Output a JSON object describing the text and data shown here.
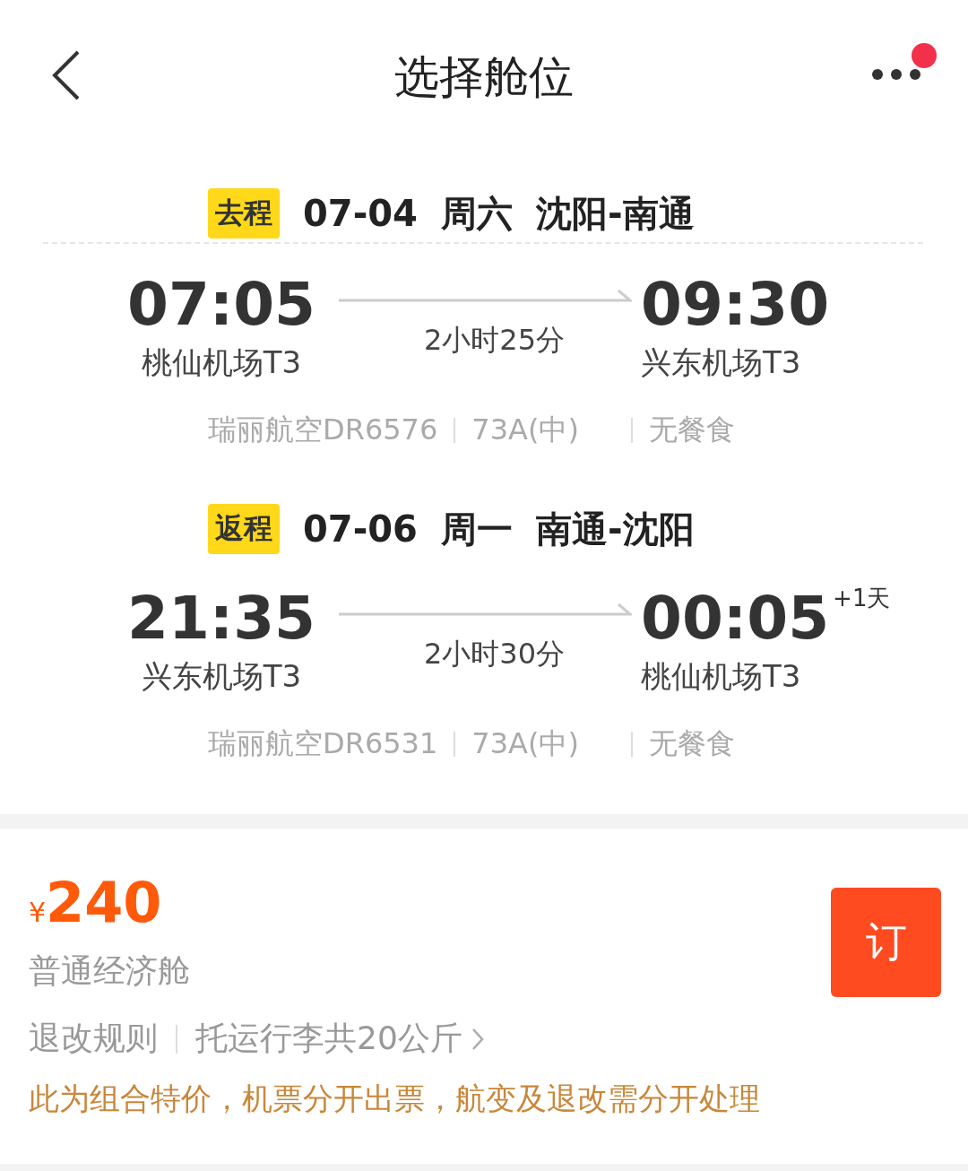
{
  "header": {
    "title": "选择舱位",
    "notification": true
  },
  "trips": [
    {
      "tag": "去程",
      "date": "07-04",
      "weekday": "周六",
      "route": "沈阳-南通",
      "depart_time": "07:05",
      "depart_airport": "桃仙机场T3",
      "duration": "2小时25分",
      "arrive_time": "09:30",
      "arrive_airport": "兴东机场T3",
      "flight": "瑞丽航空DR6576",
      "aircraft": "73A(中)",
      "meal": "无餐食"
    },
    {
      "tag": "返程",
      "date": "07-06",
      "weekday": "周一",
      "route": "南通-沈阳",
      "depart_time": "21:35",
      "depart_airport": "兴东机场T3",
      "duration": "2小时30分",
      "arrive_time": "00:05",
      "arrive_offset": "+1天",
      "arrive_airport": "桃仙机场T3",
      "flight": "瑞丽航空DR6531",
      "aircraft": "73A(中)",
      "meal": "无餐食"
    }
  ],
  "fare": {
    "currency": "¥",
    "price": "240",
    "cabin": "普通经济舱",
    "rules": "退改规则",
    "baggage": "托运行李共20公斤",
    "note": "此为组合特价，机票分开出票，航变及退改需分开处理",
    "book_button": "订"
  }
}
